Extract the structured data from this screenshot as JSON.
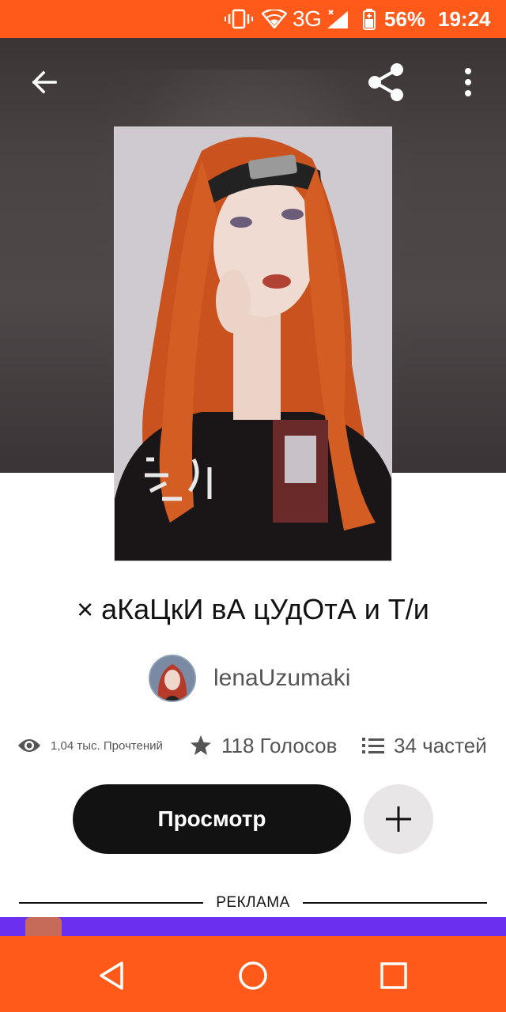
{
  "status_bar": {
    "network": "3G",
    "battery": "56%",
    "time": "19:24",
    "icons": [
      "vibrate-icon",
      "wifi-icon",
      "signal-icon",
      "battery-icon"
    ]
  },
  "toolbar": {
    "icons": [
      "back-arrow-icon",
      "share-icon",
      "more-vert-icon"
    ]
  },
  "story": {
    "title": "× аКаЦкИ вА цУдОтА и Т/и",
    "author": "lenaUzumaki",
    "reads": "1,04 тыс. Прочтений",
    "votes": "118 Голосов",
    "parts": "34 частей"
  },
  "actions": {
    "read_label": "Просмотр",
    "add_icon": "plus-icon"
  },
  "ad": {
    "label": "РЕКЛАМА"
  },
  "nav_bar": {
    "icons": [
      "nav-back-icon",
      "nav-home-icon",
      "nav-recents-icon"
    ]
  },
  "colors": {
    "accent": "#ff5a1a",
    "primary_button": "#121212",
    "ad_banner": "#6b2ff0"
  }
}
